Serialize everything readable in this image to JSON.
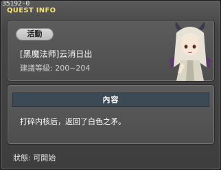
{
  "window": {
    "id_code": "35192-0",
    "title": "QUEST INFO"
  },
  "quest": {
    "tag": "活動",
    "name": "[黑魔法师]云消日出",
    "level": "建議等級: 200~204"
  },
  "content": {
    "header": "內容",
    "text": "打碎内核后，返回了白色之矛。"
  },
  "status": {
    "text": "狀態: 可開始"
  }
}
